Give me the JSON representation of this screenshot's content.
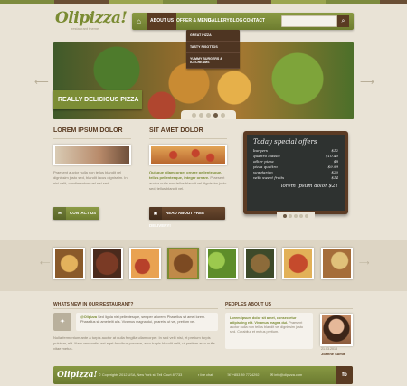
{
  "brand": {
    "name": "Olipizza!",
    "tagline": "restaurant theme"
  },
  "nav": {
    "home_icon": "home-icon",
    "items": [
      "About us",
      "Offer & Menu",
      "Gallery",
      "Blog",
      "Contact"
    ],
    "active": "About us",
    "search_placeholder": "",
    "search_icon": "search-icon"
  },
  "dropdown": {
    "items": [
      "Great pizza",
      "Tasty risottos",
      "Yummy burgers & icecreams"
    ]
  },
  "slider": {
    "caption": "Really delicious pizza",
    "pages": 5,
    "active_page": 4
  },
  "col1": {
    "title": "Lorem ipsum dolor",
    "text": "Praesent auctor nulla non tellus blandit vel dignissim justo sed, blandit lacus dignissim. In nisi velit, condimentum vel nisi sed.",
    "button": "Contact us"
  },
  "col2": {
    "title": "Sit amet dolor",
    "text_highlight": "Quisque ullamcorper ornare pellentesque, tellus pellentesque, integer ornare.",
    "text": "Praesent auctor nulla non tellus blandit vel dignissim justo sed, tellus blandit vel.",
    "button": "Read about free delivery!"
  },
  "specials": {
    "title": "Today special offers",
    "items": [
      {
        "name": "burgers",
        "price": "$12"
      },
      {
        "name": "quattro classic",
        "price": "$10.40"
      },
      {
        "name": "other pizza",
        "price": "$8"
      },
      {
        "name": "pizza quattro",
        "price": "$9.99"
      },
      {
        "name": "vegetarian",
        "price": "$20"
      },
      {
        "name": "with sweet fruits",
        "price": "$14"
      }
    ],
    "footer": "lorem ipsum dolor $21",
    "pages": 5,
    "active_page": 1
  },
  "twitter": {
    "section_title": "Whats new in our restaurant?",
    "handle": "@Olipizza",
    "tweet": "Sed ligula nisi pellentesque, semper a lorem. Phasellus sit amet lorem. Phasellus sit amet elit alls. Vivamus magna dui, pharetra ut vel, pretium vel.",
    "body": "Nulla fermentum ante a turpis auctor at nulla fringilla ullamcorper. In sed velit nisi, et pretium turpis pulvinar, elit. Nam venenatis, est eget faucibus posuere, arcu turpis blandit velit, ut pretium arcu nulla vitae metus."
  },
  "testimonial": {
    "section_title": "Peoples about us",
    "quote_highlight": "Lorem ipsum dolor sit amet, consectetur adipiscing elit. Vivamus magna dui.",
    "quote": "Praesent auctor nulla non tellus blandit vel dignissim justo sed. Curabitur et metus pretium.",
    "date": "21.03.2013",
    "author": "Joanne Sumit"
  },
  "footer": {
    "logo": "Olipizza!",
    "copyright": "© Copyrights 2012 USA, New York st. Tell Court 87733",
    "chat": "live chat",
    "phone": "+853 89 7724292",
    "email": "info@olipizza.com",
    "social": "fb"
  },
  "colors": {
    "olive": "#7a8b32",
    "brown": "#5a3b22",
    "background": "#e9e3d6",
    "board": "#2e3230"
  }
}
